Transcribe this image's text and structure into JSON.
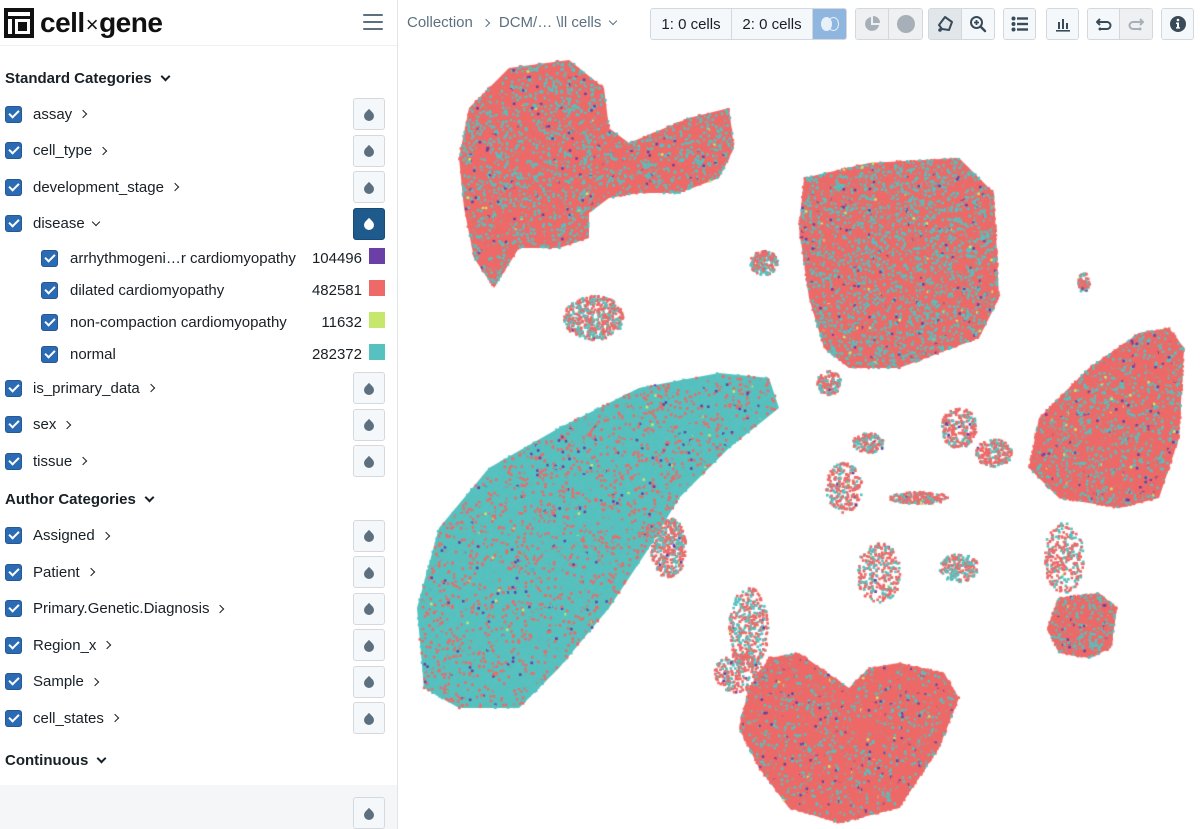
{
  "app": {
    "name_left": "cell",
    "name_x": "×",
    "name_right": "gene"
  },
  "breadcrumb": {
    "items": [
      "Collection",
      "DCM/… \\ll cells"
    ]
  },
  "toolbar": {
    "cellset1": "1: 0 cells",
    "cellset2": "2: 0 cells",
    "icons": [
      "venn-diagram-icon",
      "pie-chart-icon",
      "circle-icon",
      "lasso-icon",
      "zoom-in-icon",
      "list-icon",
      "bar-chart-icon",
      "undo-icon",
      "redo-icon",
      "info-icon"
    ]
  },
  "sidebar": {
    "standard": {
      "title": "Standard Categories",
      "items": [
        {
          "label": "assay",
          "expanded": false
        },
        {
          "label": "cell_type",
          "expanded": false
        },
        {
          "label": "development_stage",
          "expanded": false
        },
        {
          "label": "disease",
          "expanded": true,
          "color_active": true
        },
        {
          "label": "is_primary_data",
          "expanded": false
        },
        {
          "label": "sex",
          "expanded": false
        },
        {
          "label": "tissue",
          "expanded": false
        }
      ],
      "disease_values": [
        {
          "label": "arrhythmogeni…r cardiomyopathy",
          "count": "104496",
          "color": "#6a3fa6"
        },
        {
          "label": "dilated cardiomyopathy",
          "count": "482581",
          "color": "#ed6a68"
        },
        {
          "label": "non-compaction cardiomyopathy",
          "count": "11632",
          "color": "#c5e86c"
        },
        {
          "label": "normal",
          "count": "282372",
          "color": "#56c1be"
        }
      ]
    },
    "author": {
      "title": "Author Categories",
      "items": [
        {
          "label": "Assigned"
        },
        {
          "label": "Patient"
        },
        {
          "label": "Primary.Genetic.Diagnosis"
        },
        {
          "label": "Region_x"
        },
        {
          "label": "Sample"
        },
        {
          "label": "cell_states"
        }
      ]
    },
    "continuous": {
      "title": "Continuous"
    }
  },
  "colors": {
    "accent": "#2b6bb3",
    "active_button": "#1f5a8c",
    "arrhythmogenic": "#6a3fa6",
    "dilated": "#ed6a68",
    "noncompaction": "#c5e86c",
    "normal": "#56c1be"
  }
}
